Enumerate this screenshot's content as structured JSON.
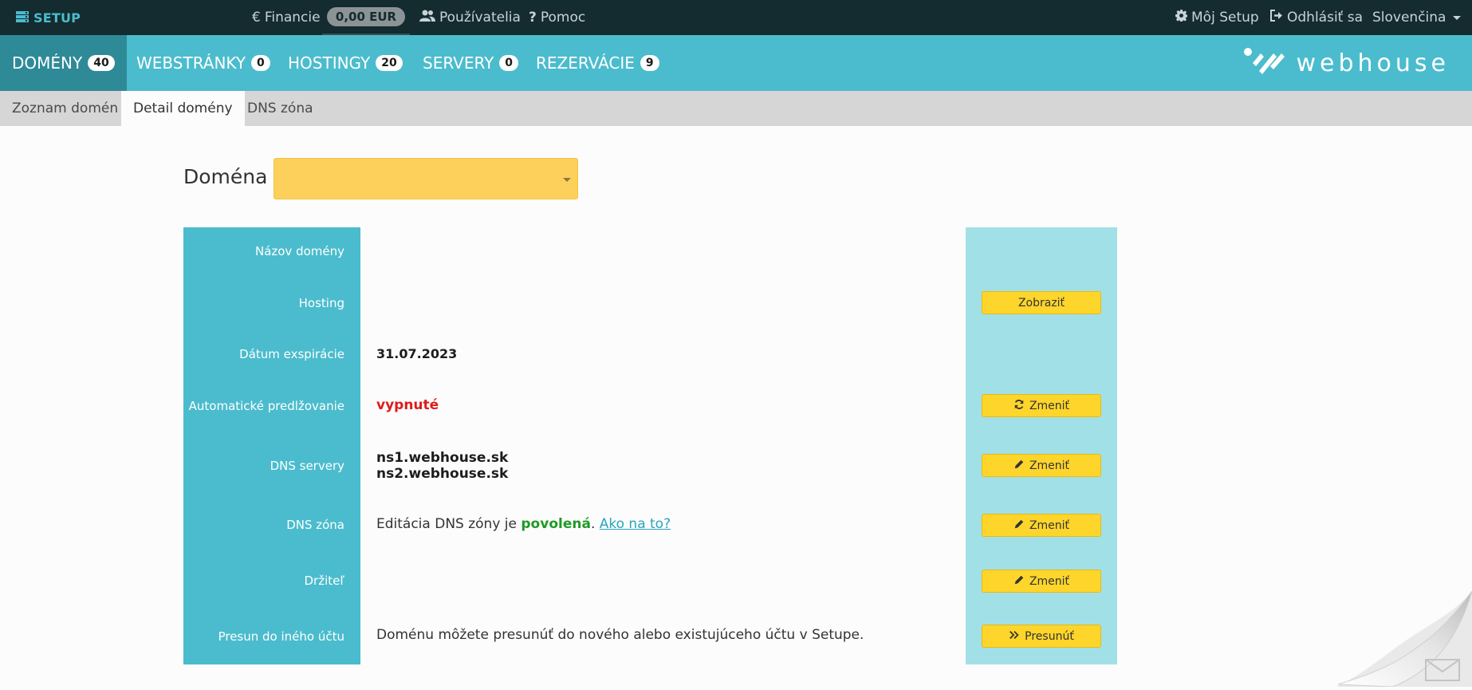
{
  "topbar": {
    "logo_label": "SETUP",
    "financie_label": "Financie",
    "financie_symbol": "€",
    "balance": "0,00 EUR",
    "users_label": "Používatelia",
    "help_label": "Pomoc",
    "my_setup_label": "Môj Setup",
    "logout_label": "Odhlásiť sa",
    "language_label": "Slovenčina"
  },
  "mainnav": {
    "tabs": [
      {
        "label": "DOMÉNY",
        "count": "40"
      },
      {
        "label": "WEBSTRÁNKY",
        "count": "0"
      },
      {
        "label": "HOSTINGY",
        "count": "20"
      },
      {
        "label": "SERVERY",
        "count": "0"
      },
      {
        "label": "REZERVÁCIE",
        "count": "9"
      }
    ],
    "brand": "webhouse"
  },
  "subnav": {
    "tabs": [
      "Zoznam domén",
      "Detail domény",
      "DNS zóna"
    ]
  },
  "domain_picker": {
    "label": "Doména",
    "value": ""
  },
  "details": {
    "rows": [
      {
        "label": "Názov domény"
      },
      {
        "label": "Hosting",
        "button": "Zobraziť"
      },
      {
        "label": "Dátum exspirácie",
        "value": "31.07.2023"
      },
      {
        "label": "Automatické predlžovanie",
        "value": "vypnuté",
        "button": "Zmeniť"
      },
      {
        "label": "DNS servery",
        "values": [
          "ns1.webhouse.sk",
          "ns2.webhouse.sk"
        ],
        "button": "Zmeniť"
      },
      {
        "label": "DNS zóna",
        "text_before": "Editácia DNS zóny je ",
        "status": "povolená",
        "text_after": ". ",
        "link": "Ako na to?",
        "button": "Zmeniť"
      },
      {
        "label": "Držiteľ",
        "button": "Zmeniť"
      },
      {
        "label": "Presun do iného účtu",
        "value": "Doménu môžete presunúť do nového alebo existujúceho účtu v Setupe.",
        "button": "Presunúť"
      }
    ]
  },
  "colors": {
    "topbar_bg": "#142b30",
    "accent": "#4bbccd",
    "accent_dark": "#2f8a98",
    "select_bg": "#fdd05c",
    "button_bg": "#fdd52b",
    "status_off": "#e01b1b",
    "status_on": "#1f9a24"
  }
}
